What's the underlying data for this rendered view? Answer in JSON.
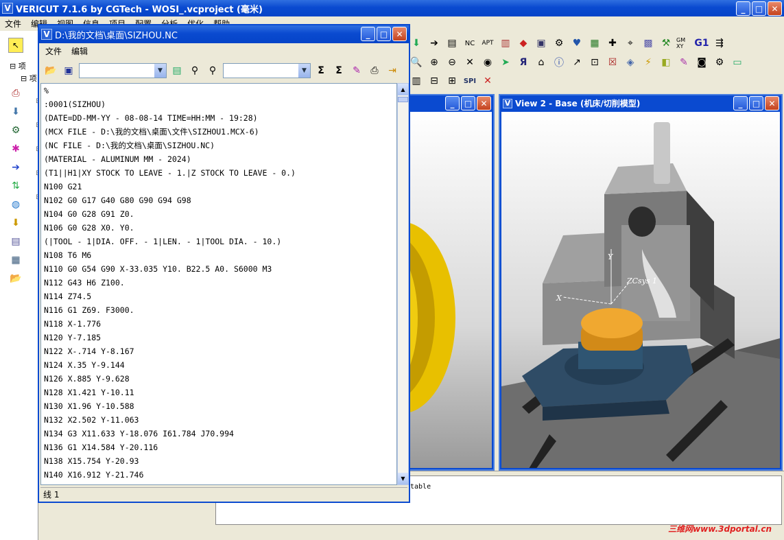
{
  "app": {
    "title": "VERICUT 7.1.6 by CGTech - WOSI_.vcproject (毫米)",
    "menu": [
      "文件",
      "编辑",
      "视图",
      "信息",
      "项目",
      "配置",
      "分析",
      "优化",
      "帮助"
    ],
    "log_text": "table"
  },
  "left_tree": {
    "item1": "项",
    "item2": "项"
  },
  "view2": {
    "title": "View 2 - Base (机床/切削模型)",
    "labels": {
      "y": "Y",
      "x": "X",
      "zcsys": "ZCsys 1"
    }
  },
  "editor": {
    "title": "D:\\我的文档\\桌面\\SIZHOU.NC",
    "menu": [
      "文件",
      "编辑"
    ],
    "combo1_value": "",
    "combo2_value": "",
    "lines": [
      "%",
      ":0001(SIZHOU)",
      "(DATE=DD-MM-YY - 08-08-14 TIME=HH:MM - 19:28)",
      "(MCX FILE - D:\\我的文档\\桌面\\文件\\SIZHOU1.MCX-6)",
      "(NC FILE - D:\\我的文档\\桌面\\SIZHOU.NC)",
      "(MATERIAL - ALUMINUM MM - 2024)",
      "(T1||H1|XY STOCK TO LEAVE - 1.|Z STOCK TO LEAVE - 0.)",
      "N100 G21",
      "N102 G0 G17 G40 G80 G90 G94 G98",
      "N104 G0 G28 G91 Z0.",
      "N106 G0 G28 X0. Y0.",
      "(|TOOL - 1|DIA. OFF. - 1|LEN. - 1|TOOL DIA. - 10.)",
      "N108 T6 M6",
      "N110 G0 G54 G90 X-33.035 Y10. B22.5 A0. S6000 M3",
      "N112 G43 H6 Z100.",
      "N114 Z74.5",
      "N116 G1 Z69. F3000.",
      "N118 X-1.776",
      "N120 Y-7.185",
      "N122 X-.714 Y-8.167",
      "N124 X.35 Y-9.144",
      "N126 X.885 Y-9.628",
      "N128 X1.421 Y-10.11",
      "N130 X1.96 Y-10.588",
      "N132 X2.502 Y-11.063",
      "N134 G3 X11.633 Y-18.076 I61.784 J70.994",
      "N136 G1 X14.584 Y-20.116",
      "N138 X15.754 Y-20.93",
      "N140 X16.912 Y-21.746"
    ],
    "status": "线 1"
  },
  "watermark": "三维网www.3dportal.cn",
  "colors": {
    "title_blue": "#0a4ad0",
    "part_orange": "#e39a1e",
    "fixture_blue": "#2f4c66"
  }
}
